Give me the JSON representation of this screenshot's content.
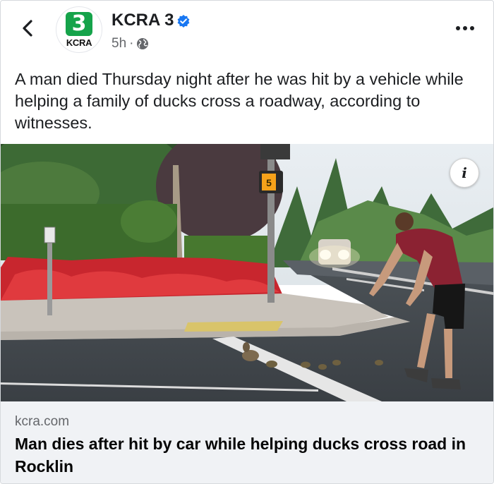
{
  "header": {
    "page_name": "KCRA 3",
    "timestamp": "5h",
    "separator": "·",
    "logo_number": "3",
    "logo_text": "KCRA",
    "brand_color": "#15a34a",
    "verified_color": "#1877f2",
    "icons": [
      "back-arrow-icon",
      "verified-badge-icon",
      "globe-icon",
      "more-options-icon"
    ]
  },
  "post": {
    "text": "A man died Thursday night after he was hit by a vehicle while helping a family of ducks cross a roadway, according to witnesses."
  },
  "photo": {
    "info_label": "i",
    "traffic_sign_label": "5"
  },
  "link_preview": {
    "domain": "kcra.com",
    "headline": "Man dies after hit by car while helping ducks cross road in Rocklin"
  }
}
